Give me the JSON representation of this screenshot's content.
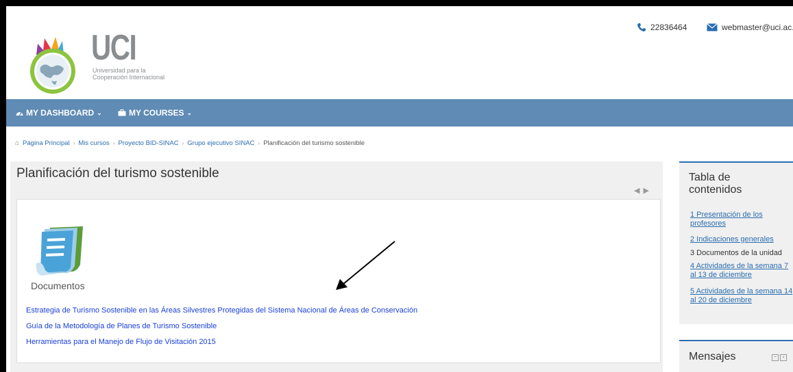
{
  "header": {
    "logo_text": "UCI",
    "logo_subtitle_line1": "Universidad para la",
    "logo_subtitle_line2": "Cooperación Internacional",
    "phone": "22836464",
    "email": "webmaster@uci.ac.c"
  },
  "navbar": {
    "dashboard_label": "MY DASHBOARD",
    "courses_label": "MY COURSES"
  },
  "breadcrumb": {
    "items": [
      "Página Principal",
      "Mis cursos",
      "Proyecto BID-SINAC",
      "Grupo ejecutivo SINAC"
    ],
    "current": "Planificación del turismo sostenible"
  },
  "main": {
    "title": "Planificación del turismo sostenible",
    "nav_arrows": "◀ ▶",
    "section_label": "Documentos",
    "links": [
      "Estrategia de Turismo Sostenible en las Áreas Silvestres Protegidas del Sistema Nacional de Áreas de Conservación",
      "Guía de la Metodología de Planes de Turismo Sostenible",
      "Herramientas para el Manejo de Flujo de Visitación 2015"
    ]
  },
  "sidebar": {
    "toc_title": "Tabla de contenidos",
    "toc_items": [
      "1 Presentación de los profesores",
      "2 Indicaciones generales",
      "3 Documentos de la unidad",
      "4 Actividades de la semana 7 al 13 de diciembre",
      "5 Actividades de la semana 14 al 20 de diciembre"
    ],
    "messages_title": "Mensajes"
  },
  "colors": {
    "navbar": "#5f8bb5",
    "link": "#1a3fd6",
    "accent": "#2a6db0"
  },
  "icons": {
    "phone": "phone-icon",
    "email": "envelope-icon",
    "dashboard": "dashboard-icon",
    "courses": "briefcase-icon",
    "home": "home-icon",
    "documents": "document-stack-icon"
  }
}
